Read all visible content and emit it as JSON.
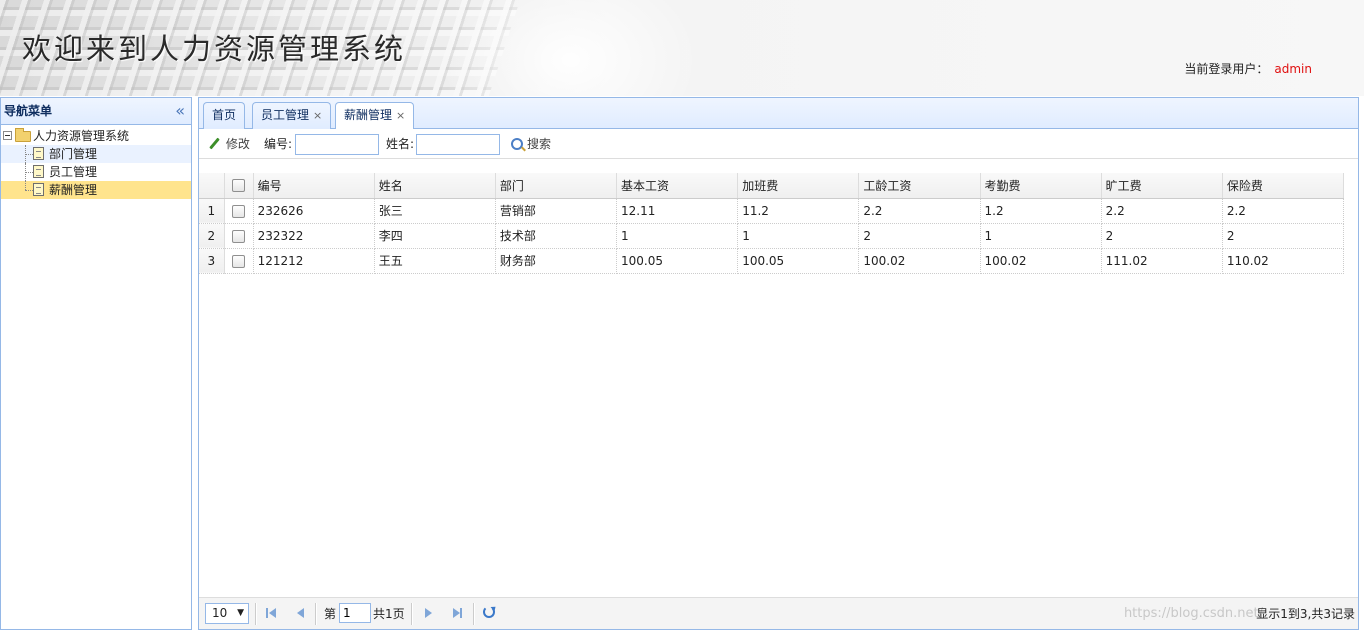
{
  "header": {
    "title": "欢迎来到人力资源管理系统",
    "user_label": "当前登录用户：",
    "user_name": "admin"
  },
  "nav": {
    "title": "导航菜单",
    "collapse_glyph": "«",
    "root_label": "人力资源管理系统",
    "items": [
      {
        "label": "部门管理"
      },
      {
        "label": "员工管理"
      },
      {
        "label": "薪酬管理"
      }
    ]
  },
  "tabs": [
    {
      "label": "首页",
      "closable": false
    },
    {
      "label": "员工管理",
      "closable": true
    },
    {
      "label": "薪酬管理",
      "closable": true
    }
  ],
  "tab_close_glyph": "×",
  "toolbar": {
    "edit_label": "修改",
    "id_label": "编号:",
    "id_value": "",
    "name_label": "姓名:",
    "name_value": "",
    "search_label": "搜索"
  },
  "grid": {
    "columns": [
      "编号",
      "姓名",
      "部门",
      "基本工资",
      "加班费",
      "工龄工资",
      "考勤费",
      "旷工费",
      "保险费"
    ],
    "rows": [
      {
        "num": "1",
        "cells": [
          "232626",
          "张三",
          "营销部",
          "12.11",
          "11.2",
          "2.2",
          "1.2",
          "2.2",
          "2.2"
        ]
      },
      {
        "num": "2",
        "cells": [
          "232322",
          "李四",
          "技术部",
          "1",
          "1",
          "2",
          "1",
          "2",
          "2"
        ]
      },
      {
        "num": "3",
        "cells": [
          "121212",
          "王五",
          "财务部",
          "100.05",
          "100.05",
          "100.02",
          "100.02",
          "111.02",
          "110.02"
        ]
      }
    ]
  },
  "pager": {
    "page_size": "10",
    "page_prefix": "第",
    "page_value": "1",
    "page_suffix": "共1页",
    "info": "显示1到3,共3记录"
  },
  "watermark": "https://blog.csdn.net/"
}
